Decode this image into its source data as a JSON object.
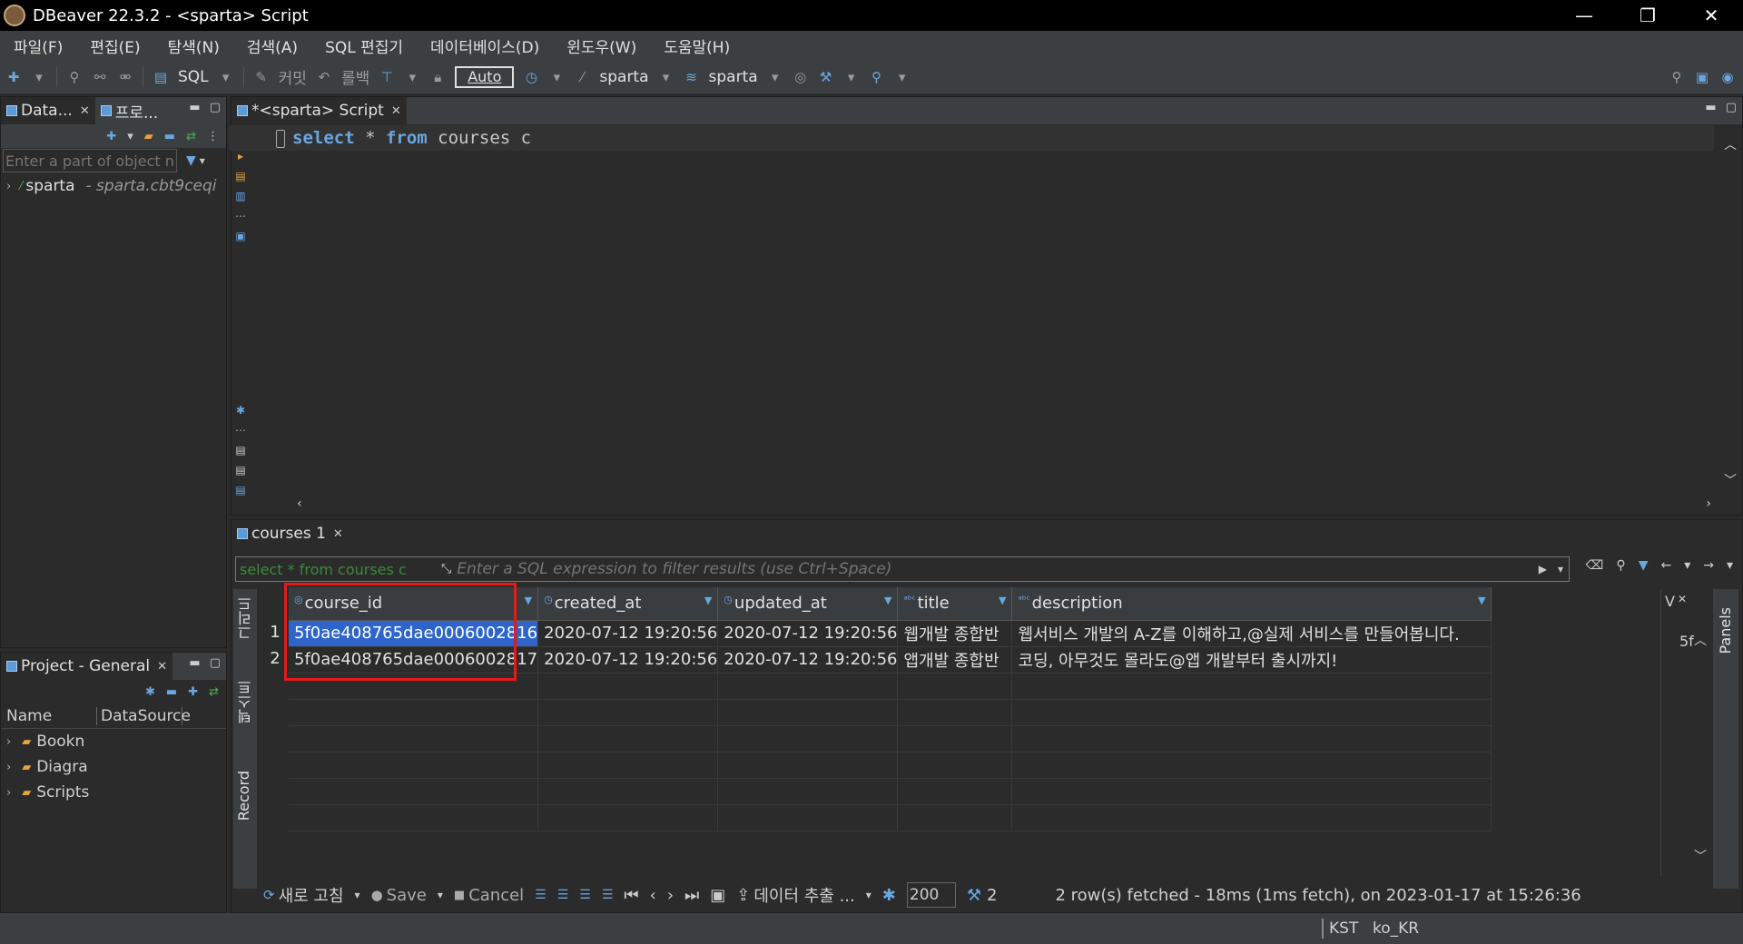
{
  "window": {
    "title": "DBeaver 22.3.2 - <sparta> Script",
    "minimize": "—",
    "restore": "❐",
    "close": "✕"
  },
  "menu": [
    "파일(F)",
    "편집(E)",
    "탐색(N)",
    "검색(A)",
    "SQL 편집기",
    "데이터베이스(D)",
    "윈도우(W)",
    "도움말(H)"
  ],
  "toolbar": {
    "sql_label": "SQL",
    "commit_label": "커밋",
    "rollback_label": "롤백",
    "auto_label": "Auto",
    "datasource_label": "sparta",
    "schema_label": "sparta"
  },
  "db_navigator": {
    "tab_label": "Data...",
    "tab2_label": "프로...",
    "filter_placeholder": "Enter a part of object n",
    "tree": [
      {
        "name": "sparta",
        "detail": "- sparta.cbt9ceqi"
      }
    ]
  },
  "project_panel": {
    "tab_label": "Project - General",
    "col_name": "Name",
    "col_datasource": "DataSource",
    "items": [
      "Bookn",
      "Diagra",
      "Scripts"
    ]
  },
  "editor": {
    "tab_label": "*<sparta> Script",
    "sql": {
      "kw1": "select",
      "star": " * ",
      "kw2": "from",
      "rest": " courses c"
    }
  },
  "results": {
    "tab_label": "courses 1",
    "query_hint": "select * from courses c",
    "filter_placeholder": "Enter a SQL expression to filter results (use Ctrl+Space)",
    "columns": [
      "course_id",
      "created_at",
      "updated_at",
      "title",
      "description"
    ],
    "rows": [
      [
        "5f0ae408765dae0006002816",
        "2020-07-12 19:20:56",
        "2020-07-12 19:20:56",
        "웹개발 종합반",
        "웹서비스 개발의 A-Z를 이해하고,@실제 서비스를 만들어봅니다."
      ],
      [
        "5f0ae408765dae0006002817",
        "2020-07-12 19:20:56",
        "2020-07-12 19:20:56",
        "앱개발 종합반",
        "코딩, 아무것도 몰라도@앱 개발부터 출시까지!"
      ]
    ],
    "row_numbers": [
      "1",
      "2"
    ],
    "side_labels": {
      "grid": "그리드",
      "text": "텍스트",
      "record": "Record",
      "panels": "Panels",
      "value": "V",
      "value_preview": "5f"
    }
  },
  "bottom_toolbar": {
    "refresh": "새로 고침",
    "save": "Save",
    "cancel": "Cancel",
    "export": "데이터 추출 ...",
    "fetch_size": "200",
    "row_count": "2",
    "status": "2 row(s) fetched - 18ms (1ms fetch), on 2023-01-17 at 15:26:36"
  },
  "statusbar": {
    "timezone": "KST",
    "locale": "ko_KR"
  }
}
